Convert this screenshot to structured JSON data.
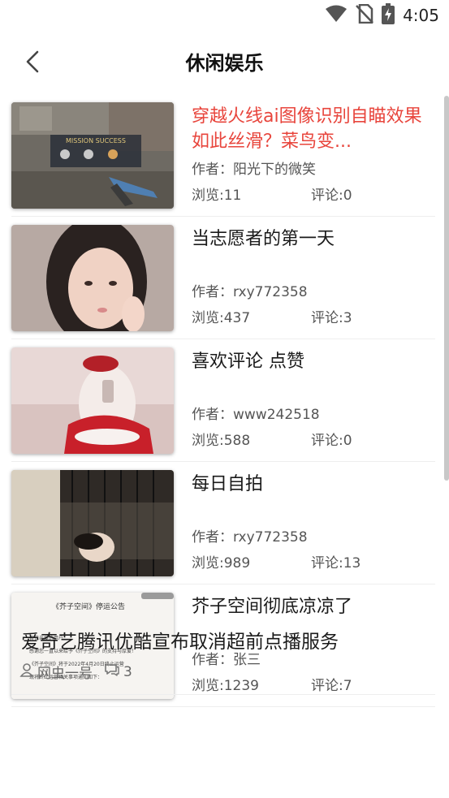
{
  "status_bar": {
    "time": "4:05",
    "icons": [
      "wifi-icon",
      "no-sim-icon",
      "battery-charging-icon"
    ]
  },
  "header": {
    "title": "休闲娱乐",
    "back_icon": "chevron-left-icon"
  },
  "posts": [
    {
      "title": "穿越火线ai图像识别自瞄效果如此丝滑？菜鸟变...",
      "author": "作者：阳光下的微笑",
      "views": "浏览:11",
      "comments": "评论:0",
      "highlighted": true,
      "thumbnail_text": "MISSION SUCCESS"
    },
    {
      "title": "当志愿者的第一天",
      "author": "作者：rxy772358",
      "views": "浏览:437",
      "comments": "评论:3",
      "highlighted": false
    },
    {
      "title": "喜欢评论 点赞",
      "author": "作者：www242518",
      "views": "浏览:588",
      "comments": "评论:0",
      "highlighted": false
    },
    {
      "title": "每日自拍",
      "author": "作者：rxy772358",
      "views": "浏览:989",
      "comments": "评论:13",
      "highlighted": false
    },
    {
      "title": "芥子空间彻底凉凉了",
      "author": "作者：张三",
      "views": "浏览:1239",
      "comments": "评论:7",
      "highlighted": false,
      "thumbnail_lines": [
        "《芥子空间》停运公告",
        "各位亲爱的用户：",
        "感谢您一直以来给予《芥子空间》的支持与厚爱！",
        "《芥子空间》将于2022年4月20日终止运营",
        "现将终止运营相关事项通知如下："
      ]
    }
  ],
  "text_post": {
    "title": "爱奇艺腾讯优酷宣布取消超前点播服务",
    "author": "网虫一号",
    "comments": "3",
    "author_icon": "user-icon",
    "comment_icon": "comment-icon"
  },
  "colors": {
    "highlight_title": "#e8453c",
    "divider": "#eeeeee",
    "meta_text": "#555555"
  }
}
